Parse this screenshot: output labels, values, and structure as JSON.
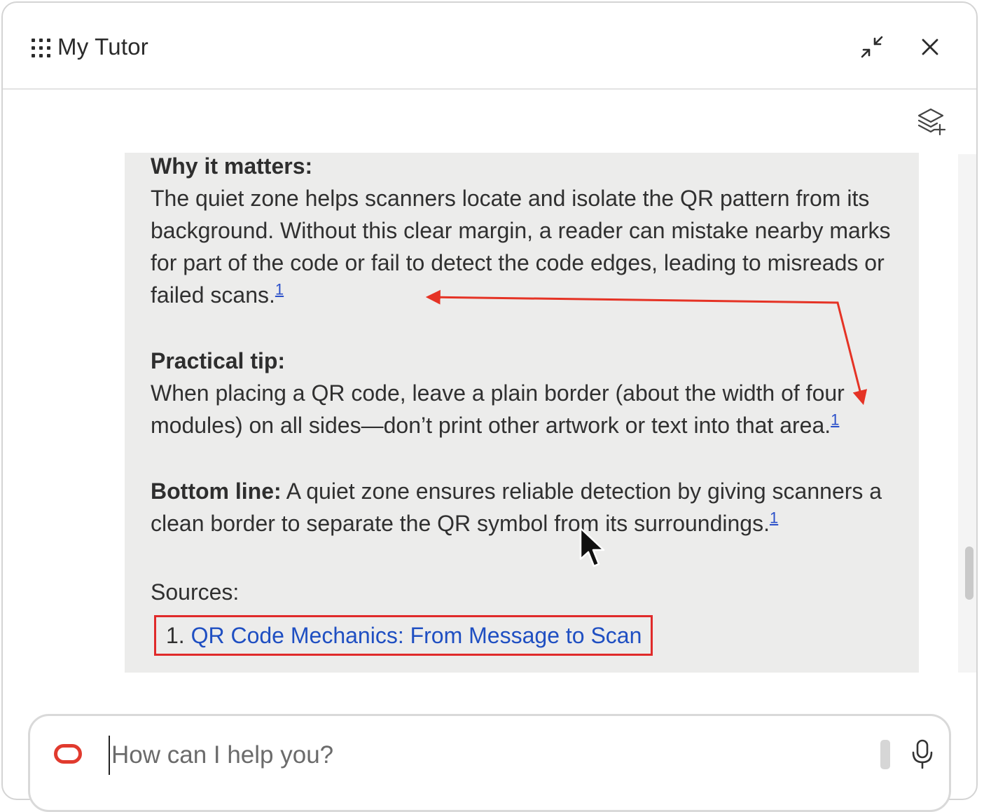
{
  "header": {
    "title": "My Tutor",
    "icons": [
      "apps-grid-icon",
      "minimize-icon",
      "close-icon"
    ]
  },
  "toolbar": {
    "icons": [
      "layers-add-icon"
    ]
  },
  "message": {
    "why": {
      "heading": "Why it matters:",
      "text": "The quiet zone helps scanners locate and isolate the QR pattern from its background. Without this clear margin, a reader can mistake nearby marks for part of the code or fail to detect the code edges, leading to misreads or failed scans.",
      "cite": "1"
    },
    "tip": {
      "heading": "Practical tip:",
      "text": "When placing a QR code, leave a plain border (about the width of four modules) on all sides—don’t print other artwork or text into that area.",
      "cite": "1"
    },
    "bottom": {
      "heading": "Bottom line:",
      "text": " A quiet zone ensures reliable detection by giving scanners a clean border to separate the QR symbol from its surroundings.",
      "cite": "1"
    },
    "sources_label": "Sources:",
    "sources": [
      {
        "number": "1.",
        "title": "QR Code Mechanics: From Message to Scan"
      }
    ]
  },
  "composer": {
    "placeholder": "How can I help you?",
    "icons": [
      "brand-logo",
      "microphone-icon"
    ]
  },
  "colors": {
    "accent_link": "#1f4fc2",
    "annotation_red": "#e02a2a",
    "brand_red": "#e13a2e",
    "bubble_bg": "#ececeb"
  }
}
